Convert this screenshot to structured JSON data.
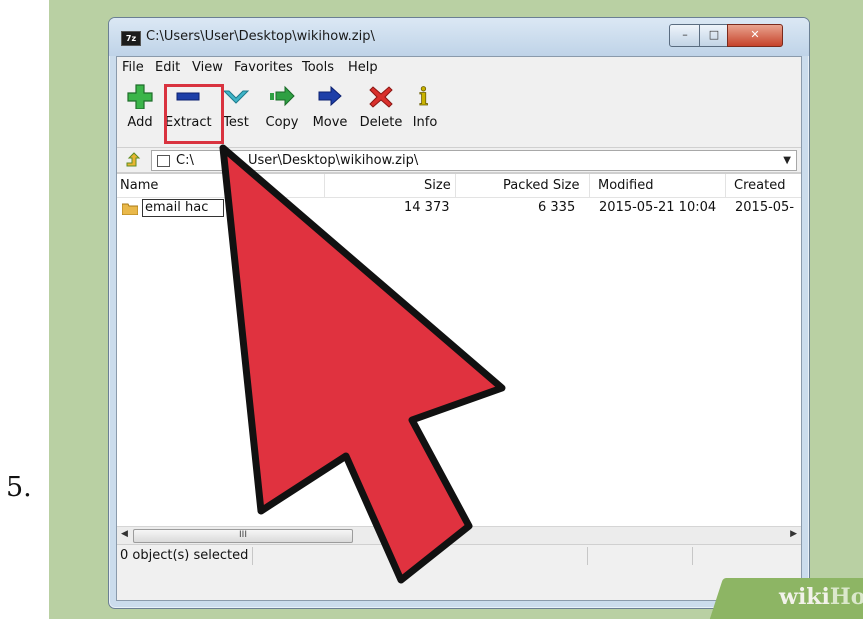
{
  "step_number": "5.",
  "window": {
    "title": "C:\\Users\\User\\Desktop\\wikihow.zip\\",
    "app_icon_label": "7z"
  },
  "menu": [
    "File",
    "Edit",
    "View",
    "Favorites",
    "Tools",
    "Help"
  ],
  "toolbar": [
    {
      "label": "Add",
      "icon": "add-icon"
    },
    {
      "label": "Extract",
      "icon": "extract-icon"
    },
    {
      "label": "Test",
      "icon": "test-icon"
    },
    {
      "label": "Copy",
      "icon": "copy-icon"
    },
    {
      "label": "Move",
      "icon": "move-icon"
    },
    {
      "label": "Delete",
      "icon": "delete-icon"
    },
    {
      "label": "Info",
      "icon": "info-icon"
    }
  ],
  "address": {
    "visible_left": "C:\\",
    "visible_right": "User\\Desktop\\wikihow.zip\\"
  },
  "columns": [
    "Name",
    "Size",
    "Packed Size",
    "Modified",
    "Created"
  ],
  "rows": [
    {
      "name": "email hac",
      "size": "14 373",
      "packed_size": "6 335",
      "modified": "2015-05-21 10:04",
      "created": "2015-05-"
    }
  ],
  "scrollbar": {
    "thumb_grip": "III"
  },
  "status": {
    "selection": "0 object(s) selected"
  },
  "watermark": {
    "part1": "wiki",
    "part2": "How"
  },
  "colors": {
    "highlight": "#d9333f",
    "pointer_fill": "#e0323f",
    "background": "#b9d0a3"
  }
}
